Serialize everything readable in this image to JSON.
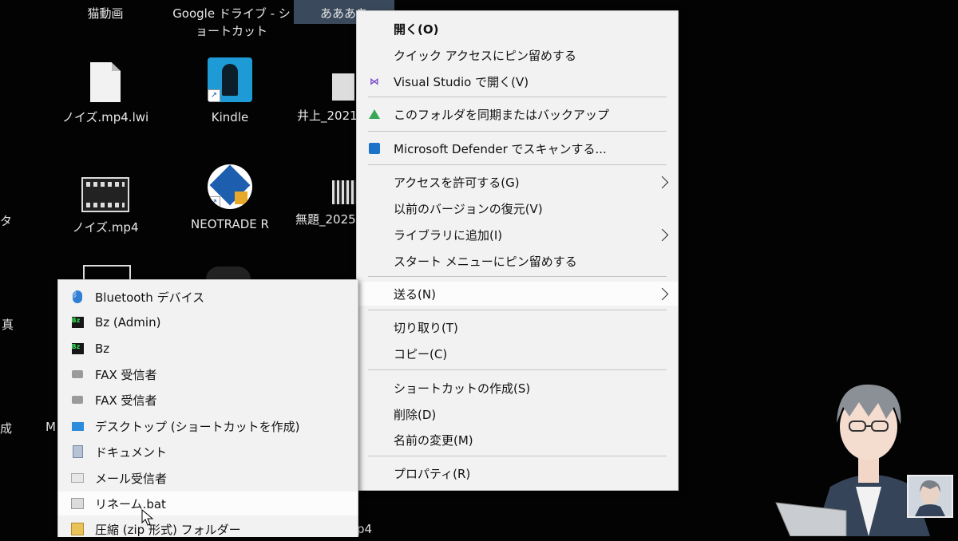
{
  "desktop": {
    "icons": [
      {
        "label": "猫動画"
      },
      {
        "label": "Google ドライブ - ショートカット"
      },
      {
        "label": "ああああ"
      },
      {
        "label": "ノイズ.mp4.lwi"
      },
      {
        "label": "Kindle"
      },
      {
        "label": "井上_2021"
      },
      {
        "label": "ノイズ.mp4"
      },
      {
        "label": "NEOTRADE R"
      },
      {
        "label": "無題_2025"
      }
    ],
    "edge_labels": [
      "タ",
      "真",
      "成",
      "M",
      "p4"
    ]
  },
  "context_menu": {
    "items": [
      {
        "label": "開く(O)",
        "icon": "none"
      },
      {
        "label": "クイック アクセスにピン留めする",
        "icon": "none"
      },
      {
        "label": "Visual Studio で開く(V)",
        "icon": "visual-studio-icon"
      },
      {
        "label": "このフォルダを同期またはバックアップ",
        "icon": "google-drive-icon"
      },
      {
        "label": "Microsoft Defender でスキャンする...",
        "icon": "defender-icon"
      },
      {
        "label": "アクセスを許可する(G)",
        "icon": "none"
      },
      {
        "label": "以前のバージョンの復元(V)",
        "icon": "none"
      },
      {
        "label": "ライブラリに追加(I)",
        "icon": "none"
      },
      {
        "label": "スタート メニューにピン留めする",
        "icon": "none"
      },
      {
        "label": "送る(N)",
        "icon": "none"
      },
      {
        "label": "切り取り(T)",
        "icon": "none"
      },
      {
        "label": "コピー(C)",
        "icon": "none"
      },
      {
        "label": "ショートカットの作成(S)",
        "icon": "none"
      },
      {
        "label": "削除(D)",
        "icon": "none"
      },
      {
        "label": "名前の変更(M)",
        "icon": "none"
      },
      {
        "label": "プロパティ(R)",
        "icon": "none"
      }
    ]
  },
  "send_to_menu": {
    "items": [
      {
        "label": "Bluetooth デバイス",
        "icon": "bluetooth-icon"
      },
      {
        "label": "Bz (Admin)",
        "icon": "bz-icon"
      },
      {
        "label": "Bz",
        "icon": "bz-icon"
      },
      {
        "label": "FAX 受信者",
        "icon": "fax-icon"
      },
      {
        "label": "FAX 受信者",
        "icon": "fax-icon"
      },
      {
        "label": "デスクトップ (ショートカットを作成)",
        "icon": "desktop-icon"
      },
      {
        "label": "ドキュメント",
        "icon": "documents-icon"
      },
      {
        "label": "メール受信者",
        "icon": "mail-icon"
      },
      {
        "label": "リネーム.bat",
        "icon": "batch-file-icon"
      },
      {
        "label": "圧縮 (zip 形式) フォルダー",
        "icon": "zip-folder-icon"
      }
    ]
  },
  "colors": {
    "desktop_bg": "#030303",
    "menu_bg": "#f2f2f2",
    "highlight_bg": "#fcfcfc"
  }
}
